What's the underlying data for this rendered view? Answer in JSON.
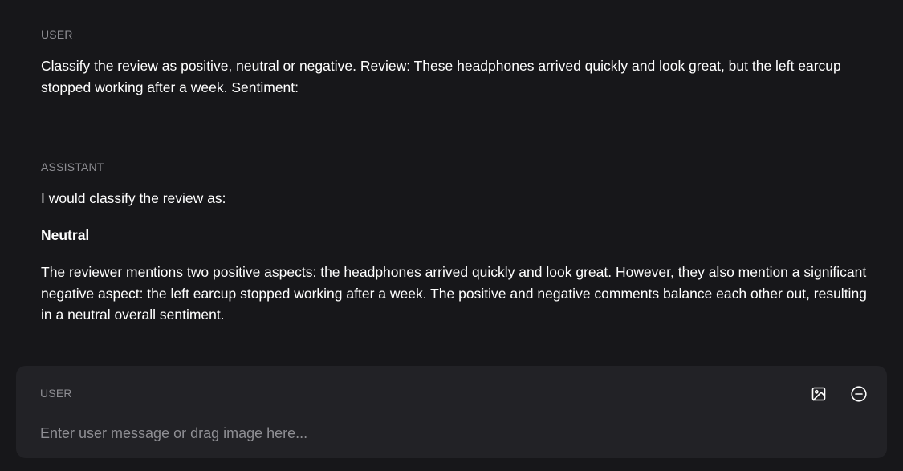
{
  "conversation": {
    "user_message": {
      "role": "USER",
      "text": "Classify the review as positive, neutral or negative. Review: These headphones arrived quickly and look great, but the left earcup stopped working after a week. Sentiment:"
    },
    "assistant_message": {
      "role": "ASSISTANT",
      "intro": "I would classify the review as:",
      "verdict": "Neutral",
      "explanation": "The reviewer mentions two positive aspects: the headphones arrived quickly and look great. However, they also mention a significant negative aspect: the left earcup stopped working after a week. The positive and negative comments balance each other out, resulting in a neutral overall sentiment."
    }
  },
  "composer": {
    "role": "USER",
    "placeholder": "Enter user message or drag image here...",
    "value": "",
    "icons": {
      "add_image": "image-icon",
      "remove": "minus-circle-icon"
    }
  },
  "colors": {
    "background": "#17171a",
    "composer_background": "#222226",
    "text": "#ffffff",
    "muted": "#8e8e93"
  }
}
